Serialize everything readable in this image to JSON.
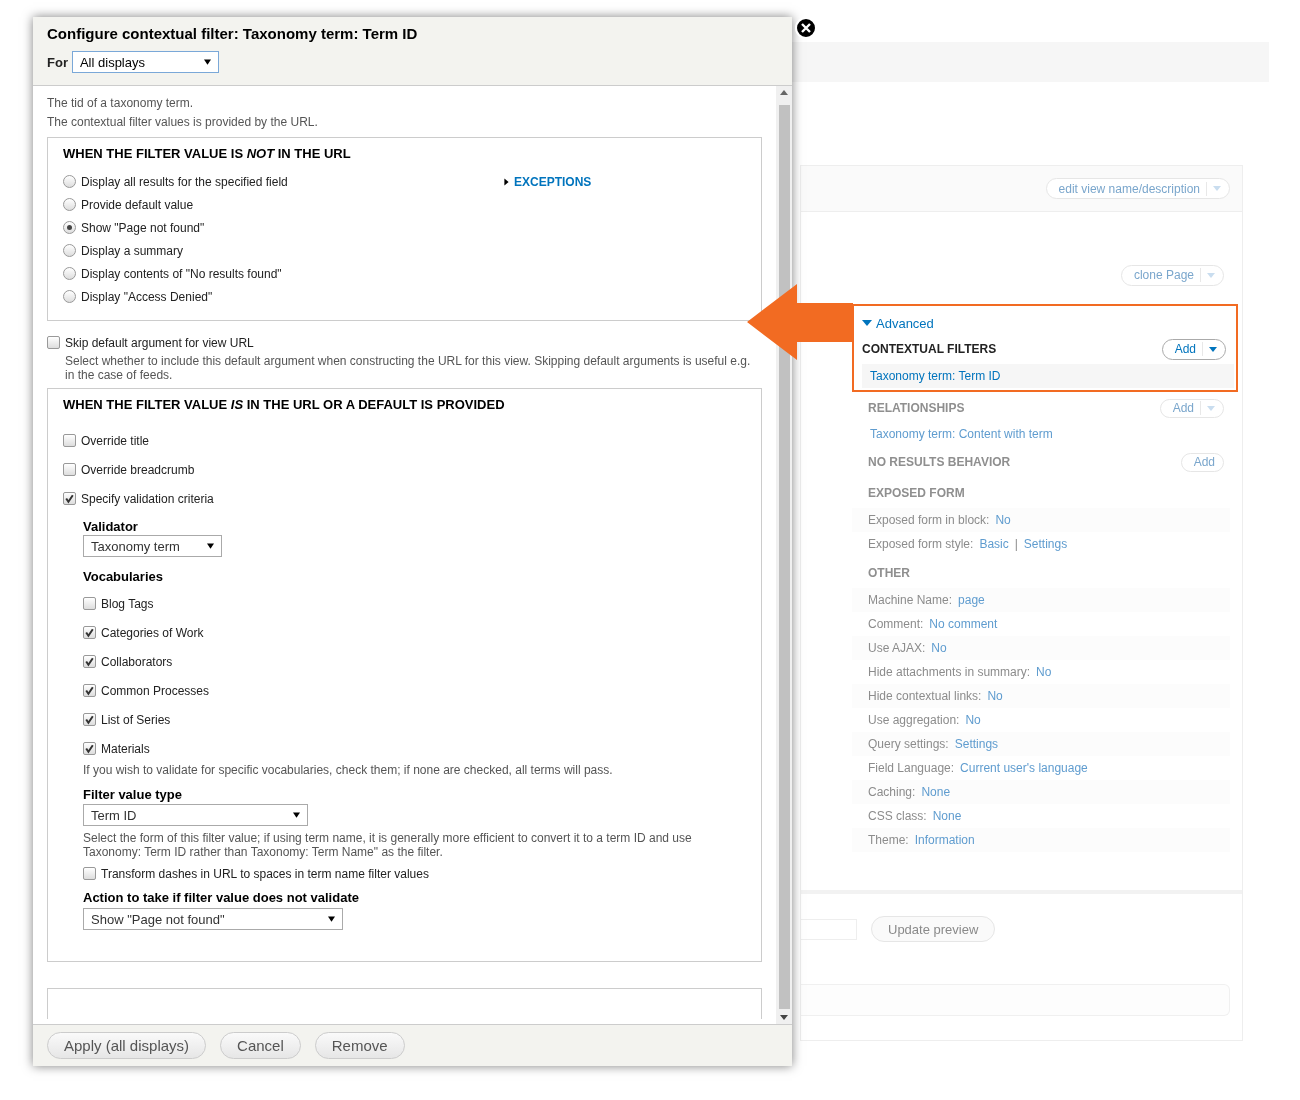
{
  "dialog": {
    "title": "Configure contextual filter: Taxonomy term: Term ID",
    "for_label": "For",
    "for_value": "All displays",
    "description": [
      "The tid of a taxonomy term.",
      "The contextual filter values is provided by the URL."
    ],
    "not_in_url": {
      "heading": "WHEN THE FILTER VALUE IS *NOT* IN THE URL",
      "options": [
        {
          "label": "Display all results for the specified field",
          "selected": false
        },
        {
          "label": "Provide default value",
          "selected": false
        },
        {
          "label": "Show \"Page not found\"",
          "selected": true
        },
        {
          "label": "Display a summary",
          "selected": false
        },
        {
          "label": "Display contents of \"No results found\"",
          "selected": false
        },
        {
          "label": "Display \"Access Denied\"",
          "selected": false
        }
      ],
      "exceptions": {
        "label": "EXCEPTIONS",
        "expanded": false
      }
    },
    "skip_default": {
      "label": "Skip default argument for view URL",
      "checked": false,
      "help": "Select whether to include this default argument when constructing the URL for this view. Skipping default arguments is useful e.g. in the case of feeds."
    },
    "in_url": {
      "heading": "WHEN THE FILTER VALUE *IS* IN THE URL OR A DEFAULT IS PROVIDED",
      "checkboxes": [
        {
          "label": "Override title",
          "checked": false
        },
        {
          "label": "Override breadcrumb",
          "checked": false
        },
        {
          "label": "Specify validation criteria",
          "checked": true
        }
      ],
      "validator": {
        "label": "Validator",
        "value": "Taxonomy term"
      },
      "vocabularies": {
        "label": "Vocabularies",
        "items": [
          {
            "label": "Blog Tags",
            "checked": false
          },
          {
            "label": "Categories of Work",
            "checked": true
          },
          {
            "label": "Collaborators",
            "checked": true
          },
          {
            "label": "Common Processes",
            "checked": true
          },
          {
            "label": "List of Series",
            "checked": true
          },
          {
            "label": "Materials",
            "checked": true
          }
        ],
        "help": "If you wish to validate for specific vocabularies, check them; if none are checked, all terms will pass."
      },
      "filter_value_type": {
        "label": "Filter value type",
        "value": "Term ID",
        "help": "Select the form of this filter value; if using term name, it is generally more efficient to convert it to a term ID and use Taxonomy: Term ID rather than Taxonomy: Term Name\" as the filter."
      },
      "transform_dashes": {
        "label": "Transform dashes in URL to spaces in term name filter values",
        "checked": false
      },
      "action": {
        "label": "Action to take if filter value does not validate",
        "value": "Show \"Page not found\""
      }
    },
    "buttons": [
      "Apply (all displays)",
      "Cancel",
      "Remove"
    ]
  },
  "background": {
    "edit_button": "edit view name/description",
    "clone_button": "clone Page",
    "advanced": {
      "label": "Advanced",
      "expanded": true,
      "highlighted": true,
      "section": {
        "heading": "CONTEXTUAL FILTERS",
        "add": "Add",
        "link": "Taxonomy term: Term ID"
      }
    },
    "sections": [
      {
        "kind": "list",
        "heading": "RELATIONSHIPS",
        "add": "Add",
        "dropdown": true,
        "links": [
          "Taxonomy term: Content with term"
        ]
      },
      {
        "kind": "list",
        "heading": "NO RESULTS BEHAVIOR",
        "add": "Add",
        "dropdown": false
      },
      {
        "kind": "settings",
        "heading": "EXPOSED FORM",
        "rows": [
          {
            "label": "Exposed form in block:",
            "values": [
              "No"
            ]
          },
          {
            "label": "Exposed form style:",
            "values": [
              "Basic",
              "Settings"
            ],
            "separator": "|"
          }
        ]
      },
      {
        "kind": "settings",
        "heading": "OTHER",
        "rows": [
          {
            "label": "Machine Name:",
            "values": [
              "page"
            ]
          },
          {
            "label": "Comment:",
            "values": [
              "No comment"
            ]
          },
          {
            "label": "Use AJAX:",
            "values": [
              "No"
            ]
          },
          {
            "label": "Hide attachments in summary:",
            "values": [
              "No"
            ]
          },
          {
            "label": "Hide contextual links:",
            "values": [
              "No"
            ]
          },
          {
            "label": "Use aggregation:",
            "values": [
              "No"
            ]
          },
          {
            "label": "Query settings:",
            "values": [
              "Settings"
            ]
          },
          {
            "label": "Field Language:",
            "values": [
              "Current user's language"
            ]
          },
          {
            "label": "Caching:",
            "values": [
              "None"
            ]
          },
          {
            "label": "CSS class:",
            "values": [
              "None"
            ]
          },
          {
            "label": "Theme:",
            "values": [
              "Information"
            ]
          }
        ]
      }
    ],
    "preview_button": "Update preview"
  }
}
